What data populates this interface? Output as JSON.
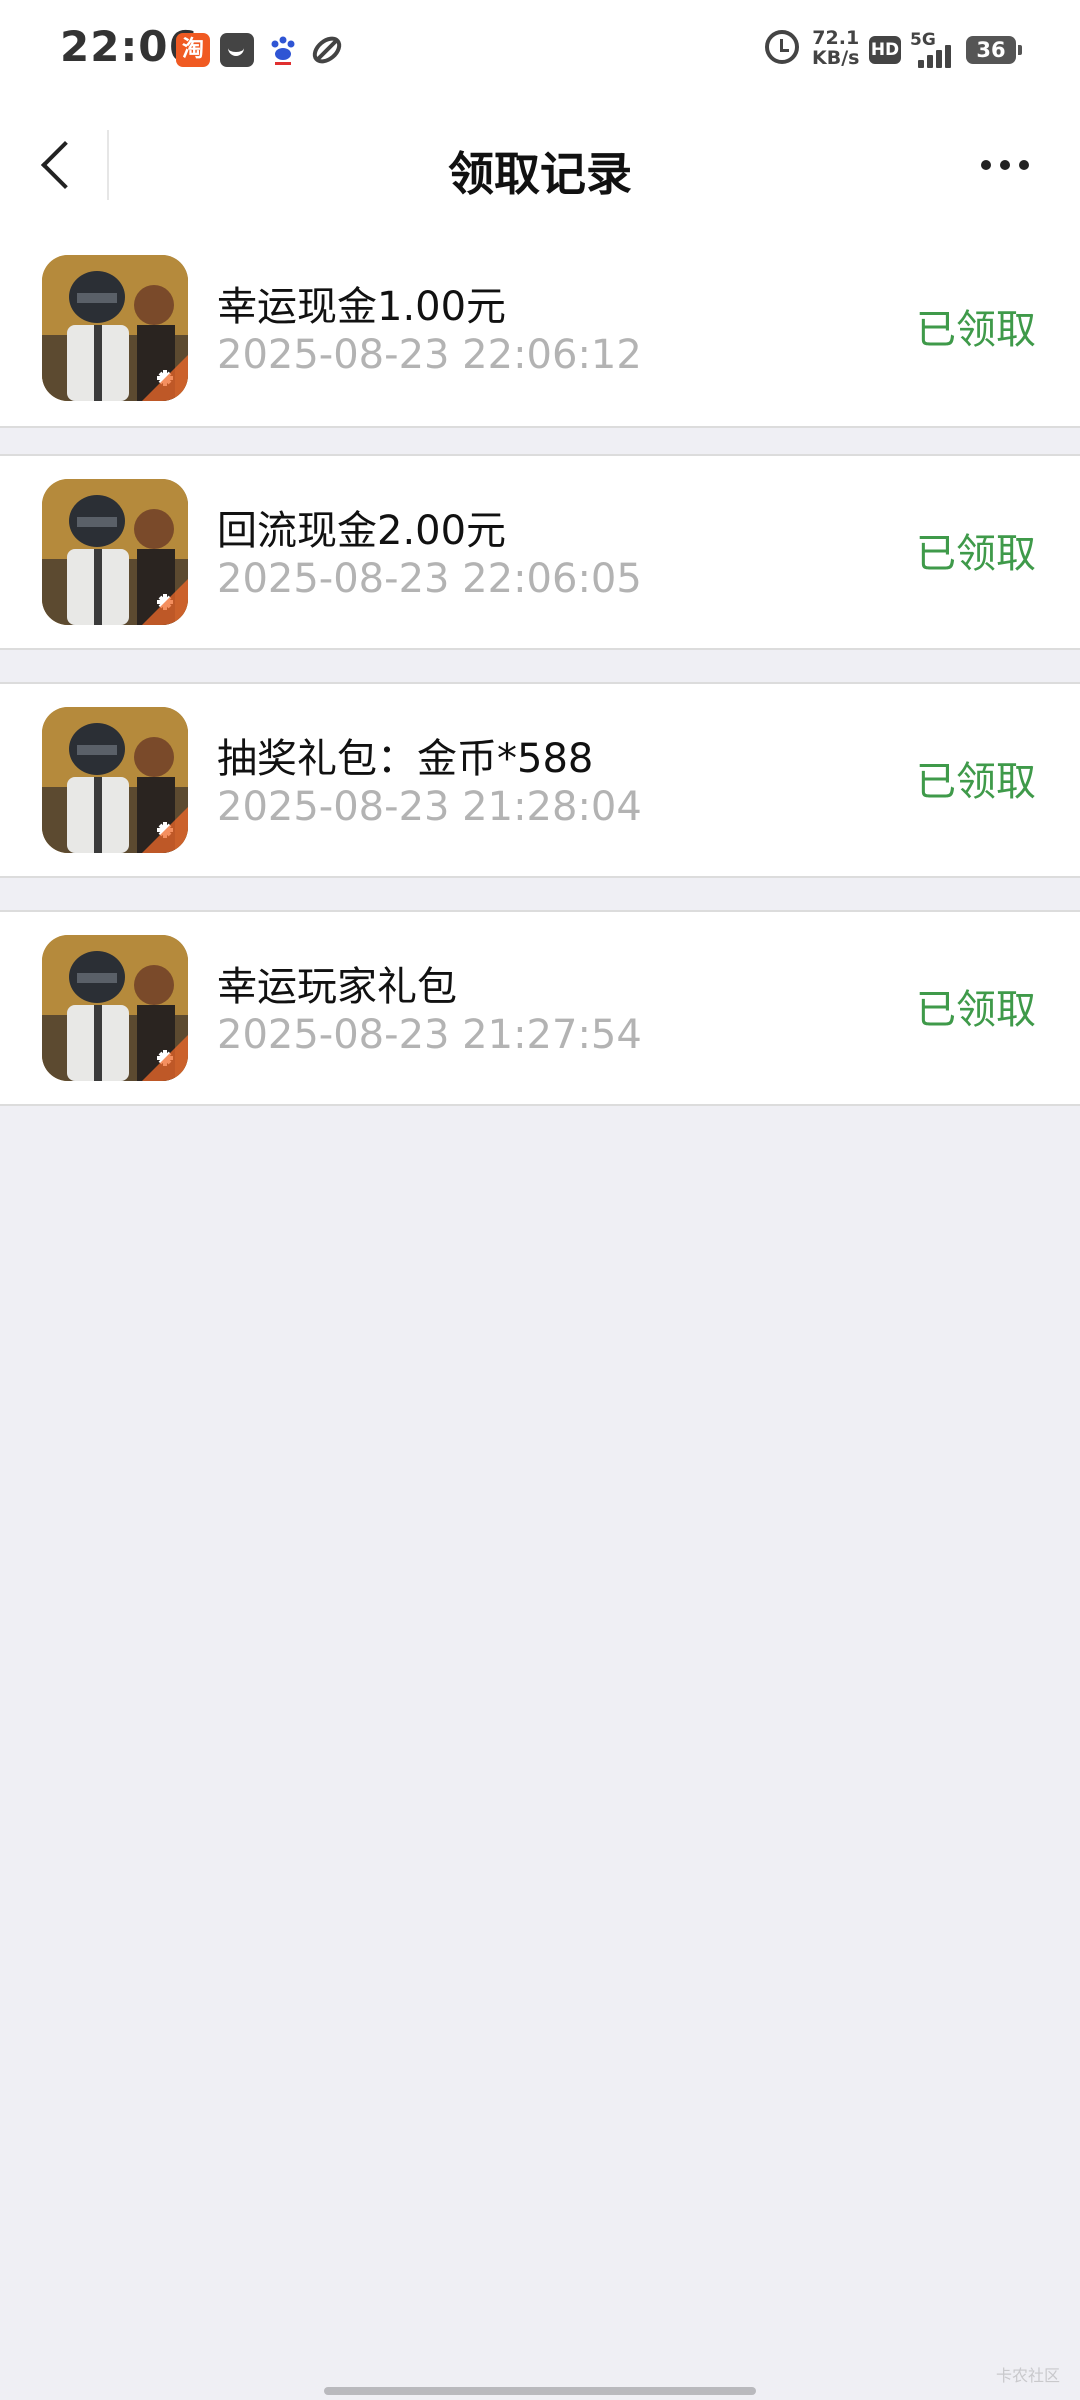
{
  "status_bar": {
    "time": "22:06",
    "taobao_glyph": "淘",
    "net_speed_value": "72.1",
    "net_speed_unit": "KB/s",
    "hd_label": "HD",
    "network_label": "5G",
    "battery_level": "36"
  },
  "nav": {
    "title": "领取记录"
  },
  "records": [
    {
      "title": "幸运现金1.00元",
      "time": "2025-08-23 22:06:12",
      "status": "已领取"
    },
    {
      "title": "回流现金2.00元",
      "time": "2025-08-23 22:06:05",
      "status": "已领取"
    },
    {
      "title": "抽奖礼包：金币*588",
      "time": "2025-08-23 21:28:04",
      "status": "已领取"
    },
    {
      "title": "幸运玩家礼包",
      "time": "2025-08-23 21:27:54",
      "status": "已领取"
    }
  ],
  "watermark": "卡农社区",
  "colors": {
    "status_green": "#3f9a4a",
    "time_gray": "#b3b3b3",
    "page_background": "#efeff4"
  }
}
